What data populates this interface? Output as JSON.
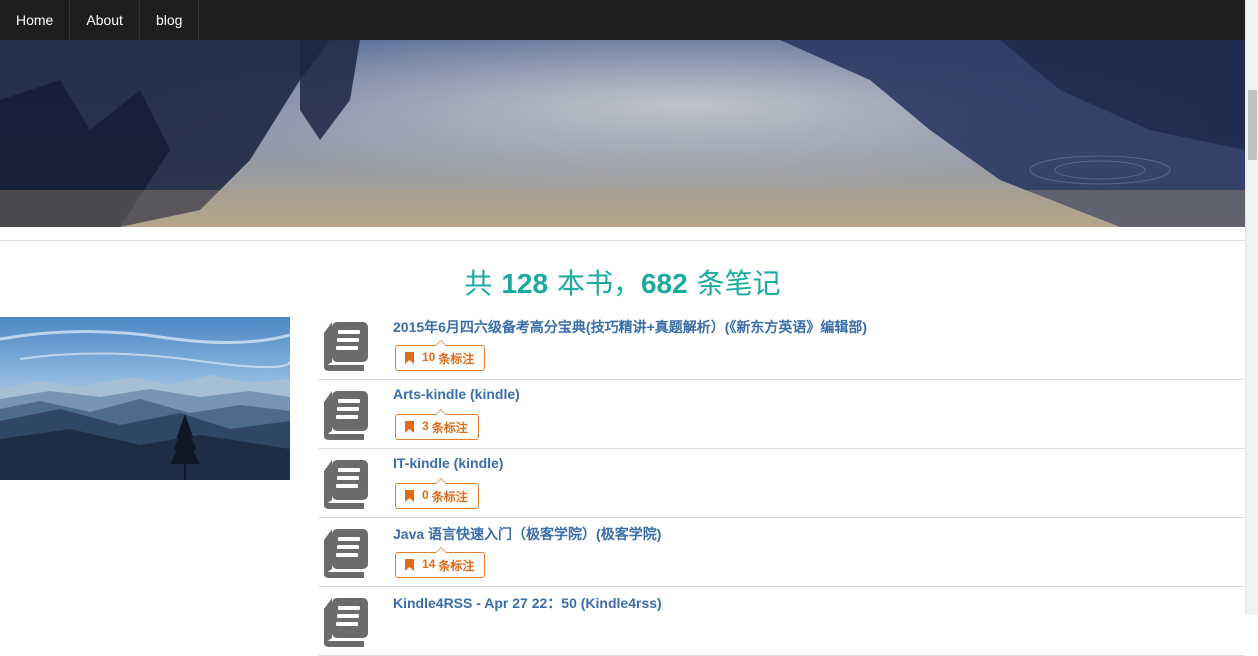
{
  "nav": {
    "items": [
      {
        "label": "Home"
      },
      {
        "label": "About"
      },
      {
        "label": "blog"
      }
    ]
  },
  "summary": {
    "prefix": "共",
    "book_count": "128",
    "mid": "本书，",
    "note_count": "682",
    "suffix": "条笔记"
  },
  "books": [
    {
      "title": "2015年6月四六级备考高分宝典(技巧精讲+真题解析）(《新东方英语》编辑部)",
      "notes": "10",
      "notes_label": "条标注"
    },
    {
      "title": "Arts-kindle (kindle)",
      "notes": "3",
      "notes_label": "条标注"
    },
    {
      "title": "IT-kindle (kindle)",
      "notes": "0",
      "notes_label": "条标注"
    },
    {
      "title": "Java 语言快速入门（极客学院）(极客学院)",
      "notes": "14",
      "notes_label": "条标注"
    },
    {
      "title": "Kindle4RSS - Apr 27 22：50 (Kindle4rss)",
      "notes": "",
      "notes_label": ""
    }
  ],
  "icons": {
    "book": "book-icon",
    "bookmark": "bookmark-icon"
  },
  "colors": {
    "accent": "#1aaba0",
    "link": "#3a6ea8",
    "badge": "#e06b18",
    "navbar": "#1e1e1e"
  }
}
